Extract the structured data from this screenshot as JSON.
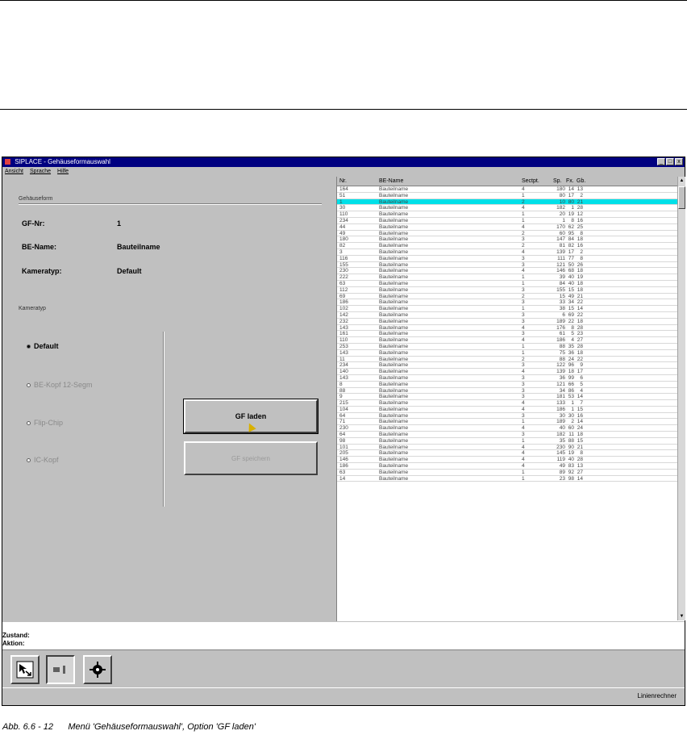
{
  "window": {
    "title": "SIPLACE - Gehäuseformauswahl",
    "buttons": [
      "_",
      "□",
      "x"
    ]
  },
  "menu": [
    "Ansicht",
    "Sprache",
    "Hilfe"
  ],
  "left": {
    "group_title": "Gehäuseform",
    "fields": [
      {
        "label": "GF-Nr:",
        "value": "1"
      },
      {
        "label": "BE-Name:",
        "value": "Bauteilname"
      },
      {
        "label": "Kameratyp:",
        "value": "Default"
      }
    ],
    "camera_group_title": "Kameratyp",
    "radios": [
      {
        "label": "Default",
        "selected": true,
        "disabled": false
      },
      {
        "label": "BE-Kopf 12-Segm",
        "selected": false,
        "disabled": true
      },
      {
        "label": "Flip-Chip",
        "selected": false,
        "disabled": true
      },
      {
        "label": "IC-Kopf",
        "selected": false,
        "disabled": true
      }
    ],
    "load_button": "GF laden",
    "save_button": "GF speichern"
  },
  "list": {
    "headers": {
      "nr": "Nr.",
      "name": "BE-Name",
      "sect": "Sectpt.",
      "sp": "Sp.",
      "fx": "Fx.",
      "gb": "Gb."
    },
    "selected_index": 2,
    "rows": [
      [
        "164",
        "Bauteilname",
        "4",
        "180",
        "14",
        "13"
      ],
      [
        "51",
        "Bauteilname",
        "1",
        "80",
        "17",
        "2"
      ],
      [
        "1",
        "Bauteilname",
        "2",
        "10",
        "80",
        "21"
      ],
      [
        "30",
        "Bauteilname",
        "4",
        "182",
        "1",
        "28"
      ],
      [
        "110",
        "Bauteilname",
        "1",
        "20",
        "19",
        "12"
      ],
      [
        "234",
        "Bauteilname",
        "1",
        "1",
        "8",
        "16"
      ],
      [
        "44",
        "Bauteilname",
        "4",
        "170",
        "62",
        "25"
      ],
      [
        "49",
        "Bauteilname",
        "2",
        "60",
        "95",
        "8"
      ],
      [
        "180",
        "Bauteilname",
        "3",
        "147",
        "84",
        "18"
      ],
      [
        "82",
        "Bauteilname",
        "2",
        "81",
        "82",
        "16"
      ],
      [
        "3",
        "Bauteilname",
        "4",
        "139",
        "17",
        "2"
      ],
      [
        "116",
        "Bauteilname",
        "3",
        "111",
        "77",
        "8"
      ],
      [
        "155",
        "Bauteilname",
        "3",
        "121",
        "50",
        "26"
      ],
      [
        "230",
        "Bauteilname",
        "4",
        "146",
        "68",
        "18"
      ],
      [
        "222",
        "Bauteilname",
        "1",
        "39",
        "40",
        "19"
      ],
      [
        "63",
        "Bauteilname",
        "1",
        "84",
        "40",
        "18"
      ],
      [
        "112",
        "Bauteilname",
        "3",
        "155",
        "15",
        "18"
      ],
      [
        "69",
        "Bauteilname",
        "2",
        "15",
        "49",
        "21"
      ],
      [
        "186",
        "Bauteilname",
        "3",
        "33",
        "34",
        "22"
      ],
      [
        "102",
        "Bauteilname",
        "1",
        "38",
        "15",
        "14"
      ],
      [
        "142",
        "Bauteilname",
        "3",
        "6",
        "69",
        "22"
      ],
      [
        "232",
        "Bauteilname",
        "3",
        "189",
        "22",
        "18"
      ],
      [
        "143",
        "Bauteilname",
        "4",
        "176",
        "8",
        "28"
      ],
      [
        "161",
        "Bauteilname",
        "3",
        "61",
        "5",
        "23"
      ],
      [
        "110",
        "Bauteilname",
        "4",
        "186",
        "4",
        "27"
      ],
      [
        "253",
        "Bauteilname",
        "1",
        "88",
        "35",
        "28"
      ],
      [
        "143",
        "Bauteilname",
        "1",
        "75",
        "36",
        "18"
      ],
      [
        "11",
        "Bauteilname",
        "2",
        "88",
        "24",
        "22"
      ],
      [
        "234",
        "Bauteilname",
        "3",
        "122",
        "96",
        "9"
      ],
      [
        "140",
        "Bauteilname",
        "4",
        "139",
        "18",
        "17"
      ],
      [
        "143",
        "Bauteilname",
        "3",
        "36",
        "99",
        "6"
      ],
      [
        "8",
        "Bauteilname",
        "3",
        "121",
        "66",
        "5"
      ],
      [
        "88",
        "Bauteilname",
        "3",
        "34",
        "86",
        "4"
      ],
      [
        "9",
        "Bauteilname",
        "3",
        "181",
        "53",
        "14"
      ],
      [
        "215",
        "Bauteilname",
        "4",
        "133",
        "1",
        "7"
      ],
      [
        "104",
        "Bauteilname",
        "4",
        "186",
        "1",
        "15"
      ],
      [
        "64",
        "Bauteilname",
        "3",
        "30",
        "30",
        "16"
      ],
      [
        "71",
        "Bauteilname",
        "1",
        "189",
        "2",
        "14"
      ],
      [
        "230",
        "Bauteilname",
        "4",
        "40",
        "60",
        "24"
      ],
      [
        "64",
        "Bauteilname",
        "3",
        "182",
        "11",
        "18"
      ],
      [
        "98",
        "Bauteilname",
        "1",
        "35",
        "88",
        "15"
      ],
      [
        "101",
        "Bauteilname",
        "4",
        "230",
        "90",
        "21"
      ],
      [
        "205",
        "Bauteilname",
        "4",
        "145",
        "19",
        "8"
      ],
      [
        "146",
        "Bauteilname",
        "4",
        "119",
        "40",
        "28"
      ],
      [
        "186",
        "Bauteilname",
        "4",
        "49",
        "83",
        "13"
      ],
      [
        "63",
        "Bauteilname",
        "1",
        "89",
        "92",
        "27"
      ],
      [
        "14",
        "Bauteilname",
        "1",
        "23",
        "98",
        "14"
      ]
    ]
  },
  "status": {
    "state_label": "Zustand:",
    "action_label": "Aktion:"
  },
  "statusbar_text": "Linienrechner",
  "caption": "Abb. 6.6 - 12      Menü 'Gehäuseformauswahl', Option 'GF laden'"
}
